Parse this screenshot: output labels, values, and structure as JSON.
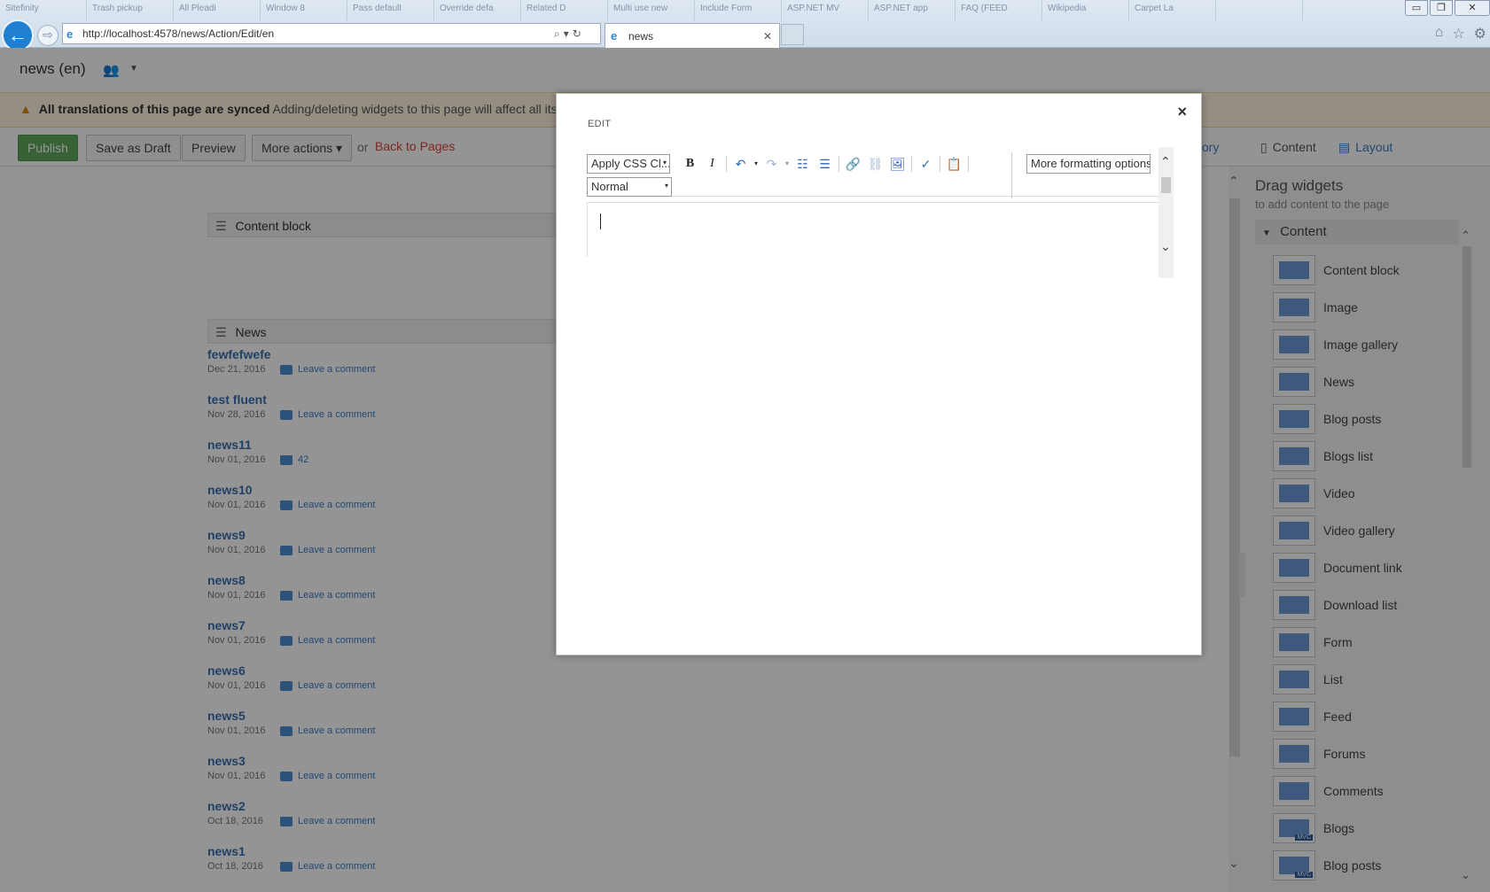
{
  "browser": {
    "bg_tabs": [
      "Sitefinity",
      "Trash pickup",
      "All Pleadi",
      "Window 8",
      "Pass default",
      "Override defa",
      "Related D",
      "Multi use new",
      "Include Form",
      "ASP.NET MV",
      "ASP.NET app",
      "FAQ (FEED",
      "Wikipedia",
      "Carpet La",
      ""
    ],
    "window_buttons": {
      "minimize": "▭",
      "restore": "❐",
      "close": "✕"
    },
    "back_icon": "←",
    "forward_icon": "⇨",
    "address": "http://localhost:4578/news/Action/Edit/en",
    "address_tools": "⌕▾↻",
    "active_tab": "news",
    "tab_close": "✕",
    "right_icons": [
      "⌂",
      "☆",
      "⚙"
    ]
  },
  "header": {
    "title": "news (en)",
    "people_icon": "👥",
    "caret": "▼"
  },
  "sync": {
    "icon": "▲",
    "strong": "All translations of this page are synced",
    "sub": "Adding/deleting widgets to this page will affect all its translations"
  },
  "toolbar": {
    "publish": "Publish",
    "save_draft": "Save as Draft",
    "preview": "Preview",
    "more_actions": "More actions ▾",
    "or": "or",
    "back_to_pages": "Back to Pages",
    "history": "tory",
    "content_tab": "Content",
    "layout_tab": "Layout",
    "content_icon": "▯",
    "layout_icon": "▤"
  },
  "canvas": {
    "content_block_head": "Content block",
    "news_head": "News",
    "hamburger": "☰",
    "news": [
      {
        "title": "fewfefwefe",
        "date": "Dec 21, 2016",
        "comment": "Leave a comment"
      },
      {
        "title": "test fluent",
        "date": "Nov 28, 2016",
        "comment": "Leave a comment"
      },
      {
        "title": "news11",
        "date": "Nov 01, 2016",
        "comment": "42"
      },
      {
        "title": "news10",
        "date": "Nov 01, 2016",
        "comment": "Leave a comment"
      },
      {
        "title": "news9",
        "date": "Nov 01, 2016",
        "comment": "Leave a comment"
      },
      {
        "title": "news8",
        "date": "Nov 01, 2016",
        "comment": "Leave a comment"
      },
      {
        "title": "news7",
        "date": "Nov 01, 2016",
        "comment": "Leave a comment"
      },
      {
        "title": "news6",
        "date": "Nov 01, 2016",
        "comment": "Leave a comment"
      },
      {
        "title": "news5",
        "date": "Nov 01, 2016",
        "comment": "Leave a comment"
      },
      {
        "title": "news3",
        "date": "Nov 01, 2016",
        "comment": "Leave a comment"
      },
      {
        "title": "news2",
        "date": "Oct 18, 2016",
        "comment": "Leave a comment"
      },
      {
        "title": "news1",
        "date": "Oct 18, 2016",
        "comment": "Leave a comment"
      }
    ],
    "scroll_up": "⌃",
    "scroll_down": "⌄"
  },
  "sidebar": {
    "title": "Drag widgets",
    "subtitle": "to add content to the page",
    "group": "Content",
    "group_caret": "▼",
    "items": [
      {
        "label": "Content block",
        "mvc": ""
      },
      {
        "label": "Image",
        "mvc": ""
      },
      {
        "label": "Image gallery",
        "mvc": ""
      },
      {
        "label": "News",
        "mvc": ""
      },
      {
        "label": "Blog posts",
        "mvc": ""
      },
      {
        "label": "Blogs list",
        "mvc": ""
      },
      {
        "label": "Video",
        "mvc": ""
      },
      {
        "label": "Video gallery",
        "mvc": ""
      },
      {
        "label": "Document link",
        "mvc": ""
      },
      {
        "label": "Download list",
        "mvc": ""
      },
      {
        "label": "Form",
        "mvc": ""
      },
      {
        "label": "List",
        "mvc": ""
      },
      {
        "label": "Feed",
        "mvc": ""
      },
      {
        "label": "Forums",
        "mvc": ""
      },
      {
        "label": "Comments",
        "mvc": ""
      },
      {
        "label": "Blogs",
        "mvc": "MVC"
      },
      {
        "label": "Blog posts",
        "mvc": "MVC"
      }
    ],
    "scroll_up": "⌃",
    "scroll_down": "⌄"
  },
  "modal": {
    "close": "×",
    "title": "EDIT",
    "css_class_select": "Apply CSS Cl...",
    "format_select": "Normal",
    "dropdown_arrow": "▾",
    "more_formatting": "More formatting options",
    "tools": {
      "bold": "B",
      "italic": "I",
      "undo": "↶",
      "undo_dd": "▾",
      "redo": "↷",
      "redo_dd": "▾",
      "ordered_list": "☷",
      "bullet_list": "☰",
      "link": "🔗",
      "unlink": "⛓",
      "image": "🖼",
      "spellcheck": "✓",
      "paste": "📋"
    },
    "scroll_up": "⌃",
    "scroll_down": "⌄"
  }
}
